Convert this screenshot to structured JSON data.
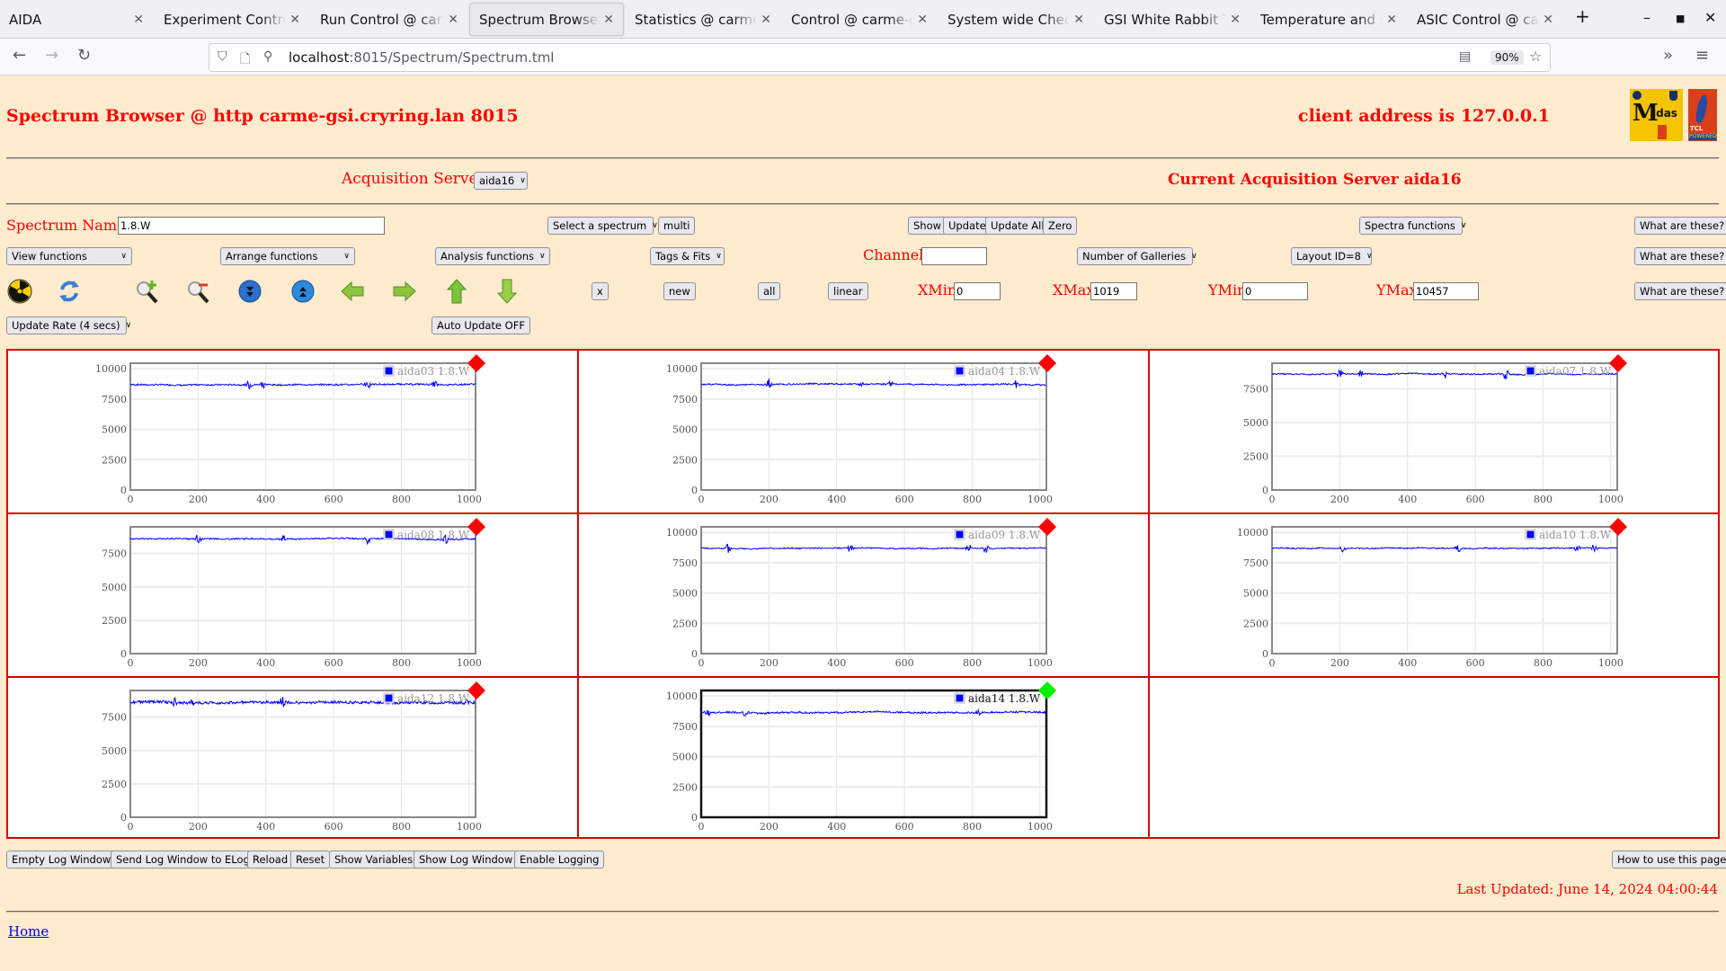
{
  "browser": {
    "tabs": [
      {
        "label": "AIDA",
        "active": false
      },
      {
        "label": "Experiment Control @ carme-gsi",
        "active": false
      },
      {
        "label": "Run Control @ carme-gsi",
        "active": false
      },
      {
        "label": "Spectrum Browser @ carme-gsi",
        "active": true
      },
      {
        "label": "Statistics @ carme-gsi",
        "active": false
      },
      {
        "label": "Control @ carme-gsi",
        "active": false
      },
      {
        "label": "System wide Checks @ carme-gsi",
        "active": false
      },
      {
        "label": "GSI White Rabbit Timing",
        "active": false
      },
      {
        "label": "Temperature and status",
        "active": false
      },
      {
        "label": "ASIC Control @ carme-gsi",
        "active": false
      }
    ],
    "new_tab": "+",
    "url_host": "localhost",
    "url_rest": ":8015/Spectrum/Spectrum.tml",
    "zoom_level": "90%"
  },
  "header": {
    "title": "Spectrum Browser @ http carme-gsi.cryring.lan 8015",
    "client_address": "client address is 127.0.0.1",
    "logo_midas": "Midas",
    "logo_tcl": "TCL",
    "logo_tcl_powered": "POWERED"
  },
  "acquisition": {
    "label": "Acquisition Servers",
    "selected": "aida16",
    "current": "Current Acquisition Server aida16"
  },
  "controls": {
    "spectrum_name_label": "Spectrum Name:",
    "spectrum_name_value": "1.8.W",
    "select_spectrum": "Select a spectrum",
    "multi": "multi",
    "show": "Show",
    "update": "Update",
    "update_all": "Update All",
    "zero": "Zero",
    "spectra_functions": "Spectra functions",
    "what_are_these": "What are these?",
    "view_functions": "View functions",
    "arrange_functions": "Arrange functions",
    "analysis_functions": "Analysis functions",
    "tags_fits": "Tags & Fits",
    "channel_label": "Channel:",
    "channel_value": "",
    "number_of_galleries": "Number of Galleries",
    "layout_id": "Layout ID=8",
    "x_button": "x",
    "new_button": "new",
    "all_button": "all",
    "linear_button": "linear",
    "xmin_label": "XMin",
    "xmin_value": "0",
    "xmax_label": "XMax",
    "xmax_value": "1019",
    "ymin_label": "YMin",
    "ymin_value": "0",
    "ymax_label": "YMax",
    "ymax_value": "10457",
    "update_rate": "Update Rate (4 secs)",
    "auto_update": "Auto Update OFF",
    "icons": [
      "radiation-icon",
      "refresh-icon",
      "zoom-in-icon",
      "zoom-out-icon",
      "expand-y-icon",
      "compress-y-icon",
      "left-arrow-icon",
      "right-arrow-icon",
      "up-arrow-icon",
      "down-arrow-icon"
    ]
  },
  "chart_data": [
    {
      "type": "line",
      "legend": "aida03 1.8.W",
      "status": "red",
      "status_color": "#ff0000",
      "xlim": [
        0,
        1019
      ],
      "ylim": [
        0,
        10457
      ],
      "xticks": [
        "0",
        "200",
        "400",
        "600",
        "800",
        "1000"
      ],
      "yticks": [
        "0",
        "2500",
        "5000",
        "7500",
        "10000"
      ],
      "baseline": 8700,
      "noise": 120,
      "bursts": [
        350,
        390,
        700,
        900
      ]
    },
    {
      "type": "line",
      "legend": "aida04 1.8.W",
      "status": "red",
      "status_color": "#ff0000",
      "xlim": [
        0,
        1019
      ],
      "ylim": [
        0,
        10457
      ],
      "xticks": [
        "0",
        "200",
        "400",
        "600",
        "800",
        "1000"
      ],
      "yticks": [
        "0",
        "2500",
        "5000",
        "7500",
        "10000"
      ],
      "baseline": 8700,
      "noise": 110,
      "bursts": [
        200,
        470,
        560,
        930
      ]
    },
    {
      "type": "line",
      "legend": "aida07 1.8.W",
      "status": "red",
      "status_color": "#ff0000",
      "xlim": [
        0,
        1019
      ],
      "ylim": [
        0,
        9400
      ],
      "xticks": [
        "0",
        "200",
        "400",
        "600",
        "800",
        "1000"
      ],
      "yticks": [
        "0",
        "2500",
        "5000",
        "7500"
      ],
      "baseline": 8600,
      "noise": 90,
      "bursts": [
        200,
        260,
        510,
        690
      ]
    },
    {
      "type": "line",
      "legend": "aida08 1.8.W",
      "status": "red",
      "status_color": "#ff0000",
      "xlim": [
        0,
        1019
      ],
      "ylim": [
        0,
        9500
      ],
      "xticks": [
        "0",
        "200",
        "400",
        "600",
        "800",
        "1000"
      ],
      "yticks": [
        "0",
        "2500",
        "5000",
        "7500"
      ],
      "baseline": 8600,
      "noise": 90,
      "bursts": [
        200,
        450,
        700,
        930
      ]
    },
    {
      "type": "line",
      "legend": "aida09 1.8.W",
      "status": "red",
      "status_color": "#ff0000",
      "xlim": [
        0,
        1019
      ],
      "ylim": [
        0,
        10457
      ],
      "xticks": [
        "0",
        "200",
        "400",
        "600",
        "800",
        "1000"
      ],
      "yticks": [
        "0",
        "2500",
        "5000",
        "7500",
        "10000"
      ],
      "baseline": 8700,
      "noise": 90,
      "bursts": [
        80,
        440,
        790,
        840
      ]
    },
    {
      "type": "line",
      "legend": "aida10 1.8.W",
      "status": "red",
      "status_color": "#ff0000",
      "xlim": [
        0,
        1019
      ],
      "ylim": [
        0,
        10457
      ],
      "xticks": [
        "0",
        "200",
        "400",
        "600",
        "800",
        "1000"
      ],
      "yticks": [
        "0",
        "2500",
        "5000",
        "7500",
        "10000"
      ],
      "baseline": 8700,
      "noise": 90,
      "bursts": [
        210,
        550,
        900,
        950
      ]
    },
    {
      "type": "line",
      "legend": "aida12 1.8.W",
      "status": "red",
      "status_color": "#ff0000",
      "xlim": [
        0,
        1019
      ],
      "ylim": [
        0,
        9500
      ],
      "xticks": [
        "0",
        "200",
        "400",
        "600",
        "800",
        "1000"
      ],
      "yticks": [
        "0",
        "2500",
        "5000",
        "7500"
      ],
      "baseline": 8600,
      "noise": 200,
      "bursts": [
        130,
        180,
        450,
        990
      ]
    },
    {
      "type": "line",
      "legend": "aida14 1.8.W",
      "status": "green",
      "status_color": "#00ee00",
      "selected": true,
      "xlim": [
        0,
        1019
      ],
      "ylim": [
        0,
        10457
      ],
      "xticks": [
        "0",
        "200",
        "400",
        "600",
        "800",
        "1000"
      ],
      "yticks": [
        "0",
        "2500",
        "5000",
        "7500",
        "10000"
      ],
      "baseline": 8650,
      "noise": 140,
      "bursts": [
        20,
        130,
        820
      ]
    }
  ],
  "footer": {
    "buttons": [
      "Empty Log Window",
      "Send Log Window to ELog",
      "Reload",
      "Reset",
      "Show Variables",
      "Show Log Window",
      "Enable Logging"
    ],
    "how_to": "How to use this page",
    "last_updated": "Last Updated: June 14, 2024 04:00:44",
    "home": "Home"
  },
  "colors": {
    "page_bg": "#ffebcd",
    "accent_red": "#ff0000",
    "trace_blue": "#0000ff"
  }
}
